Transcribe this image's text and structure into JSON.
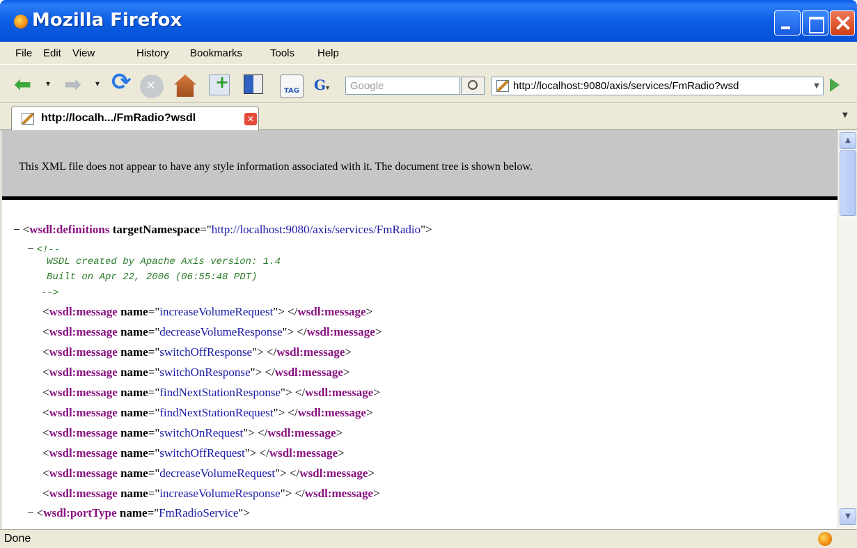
{
  "window": {
    "title": "Mozilla Firefox"
  },
  "menu": [
    "File",
    "Edit",
    "View",
    "History",
    "Bookmarks",
    "Tools",
    "Help"
  ],
  "toolbar": {
    "search_engine_label": "G",
    "search_placeholder": "Google",
    "url": "http://localhost:9080/axis/services/FmRadio?wsd",
    "tag_label": "TAG"
  },
  "tab": {
    "title": "http://localh.../FmRadio?wsdl"
  },
  "xml": {
    "notice": "This XML file does not appear to have any style information associated with it. The document tree is shown below.",
    "toggle_minus": "−",
    "root_tag": "wsdl:definitions",
    "root_attr_name": "targetNamespace",
    "root_attr_value": "http://localhost:9080/axis/services/FmRadio",
    "comment_open": "<!--",
    "comment_line1": "WSDL created by Apache Axis version: 1.4",
    "comment_line2": "Built on Apr 22, 2006 (06:55:48 PDT)",
    "comment_close": "-->",
    "message_tag": "wsdl:message",
    "message_attr": "name",
    "messages": [
      "increaseVolumeRequest",
      "decreaseVolumeResponse",
      "switchOffResponse",
      "switchOnResponse",
      "findNextStationResponse",
      "findNextStationRequest",
      "switchOnRequest",
      "switchOffRequest",
      "decreaseVolumeRequest",
      "increaseVolumeResponse"
    ],
    "porttype_tag": "wsdl:portType",
    "porttype_attr": "name",
    "porttype_value": "FmRadioService"
  },
  "status": {
    "text": "Done"
  }
}
